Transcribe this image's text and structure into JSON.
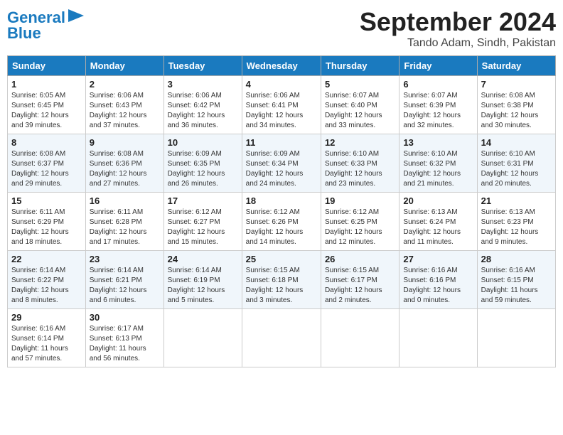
{
  "header": {
    "logo_line1": "General",
    "logo_line2": "Blue",
    "title": "September 2024",
    "subtitle": "Tando Adam, Sindh, Pakistan"
  },
  "columns": [
    "Sunday",
    "Monday",
    "Tuesday",
    "Wednesday",
    "Thursday",
    "Friday",
    "Saturday"
  ],
  "weeks": [
    [
      {
        "day": "1",
        "info": "Sunrise: 6:05 AM\nSunset: 6:45 PM\nDaylight: 12 hours\nand 39 minutes."
      },
      {
        "day": "2",
        "info": "Sunrise: 6:06 AM\nSunset: 6:43 PM\nDaylight: 12 hours\nand 37 minutes."
      },
      {
        "day": "3",
        "info": "Sunrise: 6:06 AM\nSunset: 6:42 PM\nDaylight: 12 hours\nand 36 minutes."
      },
      {
        "day": "4",
        "info": "Sunrise: 6:06 AM\nSunset: 6:41 PM\nDaylight: 12 hours\nand 34 minutes."
      },
      {
        "day": "5",
        "info": "Sunrise: 6:07 AM\nSunset: 6:40 PM\nDaylight: 12 hours\nand 33 minutes."
      },
      {
        "day": "6",
        "info": "Sunrise: 6:07 AM\nSunset: 6:39 PM\nDaylight: 12 hours\nand 32 minutes."
      },
      {
        "day": "7",
        "info": "Sunrise: 6:08 AM\nSunset: 6:38 PM\nDaylight: 12 hours\nand 30 minutes."
      }
    ],
    [
      {
        "day": "8",
        "info": "Sunrise: 6:08 AM\nSunset: 6:37 PM\nDaylight: 12 hours\nand 29 minutes."
      },
      {
        "day": "9",
        "info": "Sunrise: 6:08 AM\nSunset: 6:36 PM\nDaylight: 12 hours\nand 27 minutes."
      },
      {
        "day": "10",
        "info": "Sunrise: 6:09 AM\nSunset: 6:35 PM\nDaylight: 12 hours\nand 26 minutes."
      },
      {
        "day": "11",
        "info": "Sunrise: 6:09 AM\nSunset: 6:34 PM\nDaylight: 12 hours\nand 24 minutes."
      },
      {
        "day": "12",
        "info": "Sunrise: 6:10 AM\nSunset: 6:33 PM\nDaylight: 12 hours\nand 23 minutes."
      },
      {
        "day": "13",
        "info": "Sunrise: 6:10 AM\nSunset: 6:32 PM\nDaylight: 12 hours\nand 21 minutes."
      },
      {
        "day": "14",
        "info": "Sunrise: 6:10 AM\nSunset: 6:31 PM\nDaylight: 12 hours\nand 20 minutes."
      }
    ],
    [
      {
        "day": "15",
        "info": "Sunrise: 6:11 AM\nSunset: 6:29 PM\nDaylight: 12 hours\nand 18 minutes."
      },
      {
        "day": "16",
        "info": "Sunrise: 6:11 AM\nSunset: 6:28 PM\nDaylight: 12 hours\nand 17 minutes."
      },
      {
        "day": "17",
        "info": "Sunrise: 6:12 AM\nSunset: 6:27 PM\nDaylight: 12 hours\nand 15 minutes."
      },
      {
        "day": "18",
        "info": "Sunrise: 6:12 AM\nSunset: 6:26 PM\nDaylight: 12 hours\nand 14 minutes."
      },
      {
        "day": "19",
        "info": "Sunrise: 6:12 AM\nSunset: 6:25 PM\nDaylight: 12 hours\nand 12 minutes."
      },
      {
        "day": "20",
        "info": "Sunrise: 6:13 AM\nSunset: 6:24 PM\nDaylight: 12 hours\nand 11 minutes."
      },
      {
        "day": "21",
        "info": "Sunrise: 6:13 AM\nSunset: 6:23 PM\nDaylight: 12 hours\nand 9 minutes."
      }
    ],
    [
      {
        "day": "22",
        "info": "Sunrise: 6:14 AM\nSunset: 6:22 PM\nDaylight: 12 hours\nand 8 minutes."
      },
      {
        "day": "23",
        "info": "Sunrise: 6:14 AM\nSunset: 6:21 PM\nDaylight: 12 hours\nand 6 minutes."
      },
      {
        "day": "24",
        "info": "Sunrise: 6:14 AM\nSunset: 6:19 PM\nDaylight: 12 hours\nand 5 minutes."
      },
      {
        "day": "25",
        "info": "Sunrise: 6:15 AM\nSunset: 6:18 PM\nDaylight: 12 hours\nand 3 minutes."
      },
      {
        "day": "26",
        "info": "Sunrise: 6:15 AM\nSunset: 6:17 PM\nDaylight: 12 hours\nand 2 minutes."
      },
      {
        "day": "27",
        "info": "Sunrise: 6:16 AM\nSunset: 6:16 PM\nDaylight: 12 hours\nand 0 minutes."
      },
      {
        "day": "28",
        "info": "Sunrise: 6:16 AM\nSunset: 6:15 PM\nDaylight: 11 hours\nand 59 minutes."
      }
    ],
    [
      {
        "day": "29",
        "info": "Sunrise: 6:16 AM\nSunset: 6:14 PM\nDaylight: 11 hours\nand 57 minutes."
      },
      {
        "day": "30",
        "info": "Sunrise: 6:17 AM\nSunset: 6:13 PM\nDaylight: 11 hours\nand 56 minutes."
      },
      null,
      null,
      null,
      null,
      null
    ]
  ]
}
